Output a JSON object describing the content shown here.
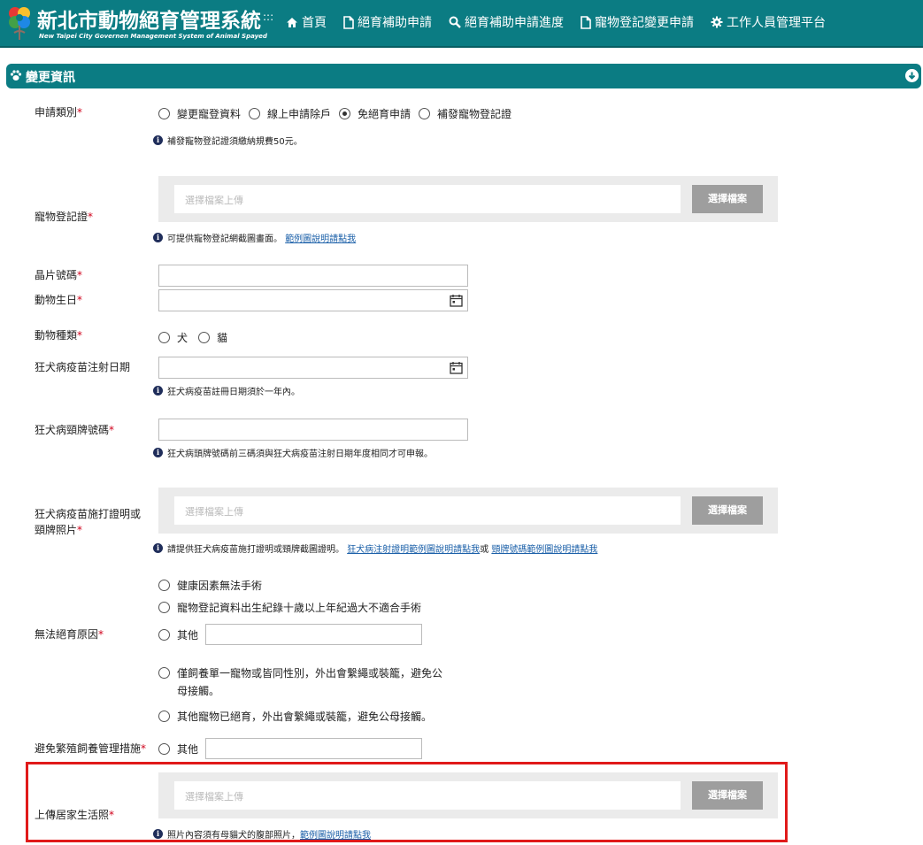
{
  "header": {
    "title": "新北市動物絕育管理系統",
    "subtitle": "New Taipei City Governen Management System of Animal Spayed",
    "title_suffix": ":::",
    "nav": [
      {
        "label": "首頁",
        "icon": "home-icon"
      },
      {
        "label": "絕育補助申請",
        "icon": "document-icon"
      },
      {
        "label": "絕育補助申請進度",
        "icon": "search-icon"
      },
      {
        "label": "寵物登記變更申請",
        "icon": "document-icon"
      },
      {
        "label": "工作人員管理平台",
        "icon": "gear-icon"
      }
    ]
  },
  "section": {
    "title": "變更資訊",
    "icon": "paw-icon",
    "collapse_icon": "circle-arrow-down-icon"
  },
  "form": {
    "apply_type": {
      "label": "申請類別",
      "options": [
        "變更寵登資料",
        "線上申請除戶",
        "免絕育申請",
        "補發寵物登記證"
      ],
      "selected": "免絕育申請",
      "hint": "補發寵物登記證須繳納規費50元。"
    },
    "pet_cert": {
      "label": "寵物登記證",
      "placeholder": "選擇檔案上傳",
      "button": "選擇檔案",
      "hint": "可提供寵物登記網截圖畫面。",
      "hint_link": "範例圖說明請點我"
    },
    "chip": {
      "label": "晶片號碼"
    },
    "birthday": {
      "label": "動物生日"
    },
    "species": {
      "label": "動物種類",
      "options": [
        "犬",
        "貓"
      ]
    },
    "rabies_date": {
      "label": "狂犬病疫苗注射日期",
      "hint": "狂犬病疫苗註冊日期須於一年內。"
    },
    "rabies_tag": {
      "label": "狂犬病頸牌號碼",
      "hint": "狂犬病頭牌號碼前三碼須與狂犬病疫苗注射日期年度相同才可申報。"
    },
    "rabies_proof": {
      "label_line1": "狂犬病疫苗施打證明或",
      "label_line2": "頸牌照片",
      "placeholder": "選擇檔案上傳",
      "button": "選擇檔案",
      "hint": "請提供狂犬病疫苗施打證明或頸牌截圖證明。",
      "hint_link1": "狂犬病注射證明範例圖說明請點我",
      "hint_joiner": "或",
      "hint_link2": "頸牌號碼範例圖說明請點我"
    },
    "reason": {
      "label": "無法絕育原因",
      "options": [
        "健康因素無法手術",
        "寵物登記資料出生紀錄十歲以上年紀過大不適合手術",
        "其他"
      ]
    },
    "measure": {
      "label": "避免繁殖飼養管理措施",
      "option1_line1": "僅飼養單一寵物或皆同性別，外出會繫繩或裝籠，避免公",
      "option1_line2": "母接觸。",
      "option2": "其他寵物已絕育，外出會繫繩或裝籠，避免公母接觸。",
      "option3": "其他"
    },
    "life_photo": {
      "label": "上傳居家生活照",
      "placeholder": "選擇檔案上傳",
      "button": "選擇檔案",
      "hint": "照片內容須有母貓犬的腹部照片，",
      "hint_link": "範例圖說明請點我"
    },
    "required_mark": "*",
    "info_glyph": "i"
  },
  "colors": {
    "primary": "#0b7c83",
    "required": "#d0021b",
    "highlight": "#e01a1a",
    "link": "#1a5fa8"
  }
}
